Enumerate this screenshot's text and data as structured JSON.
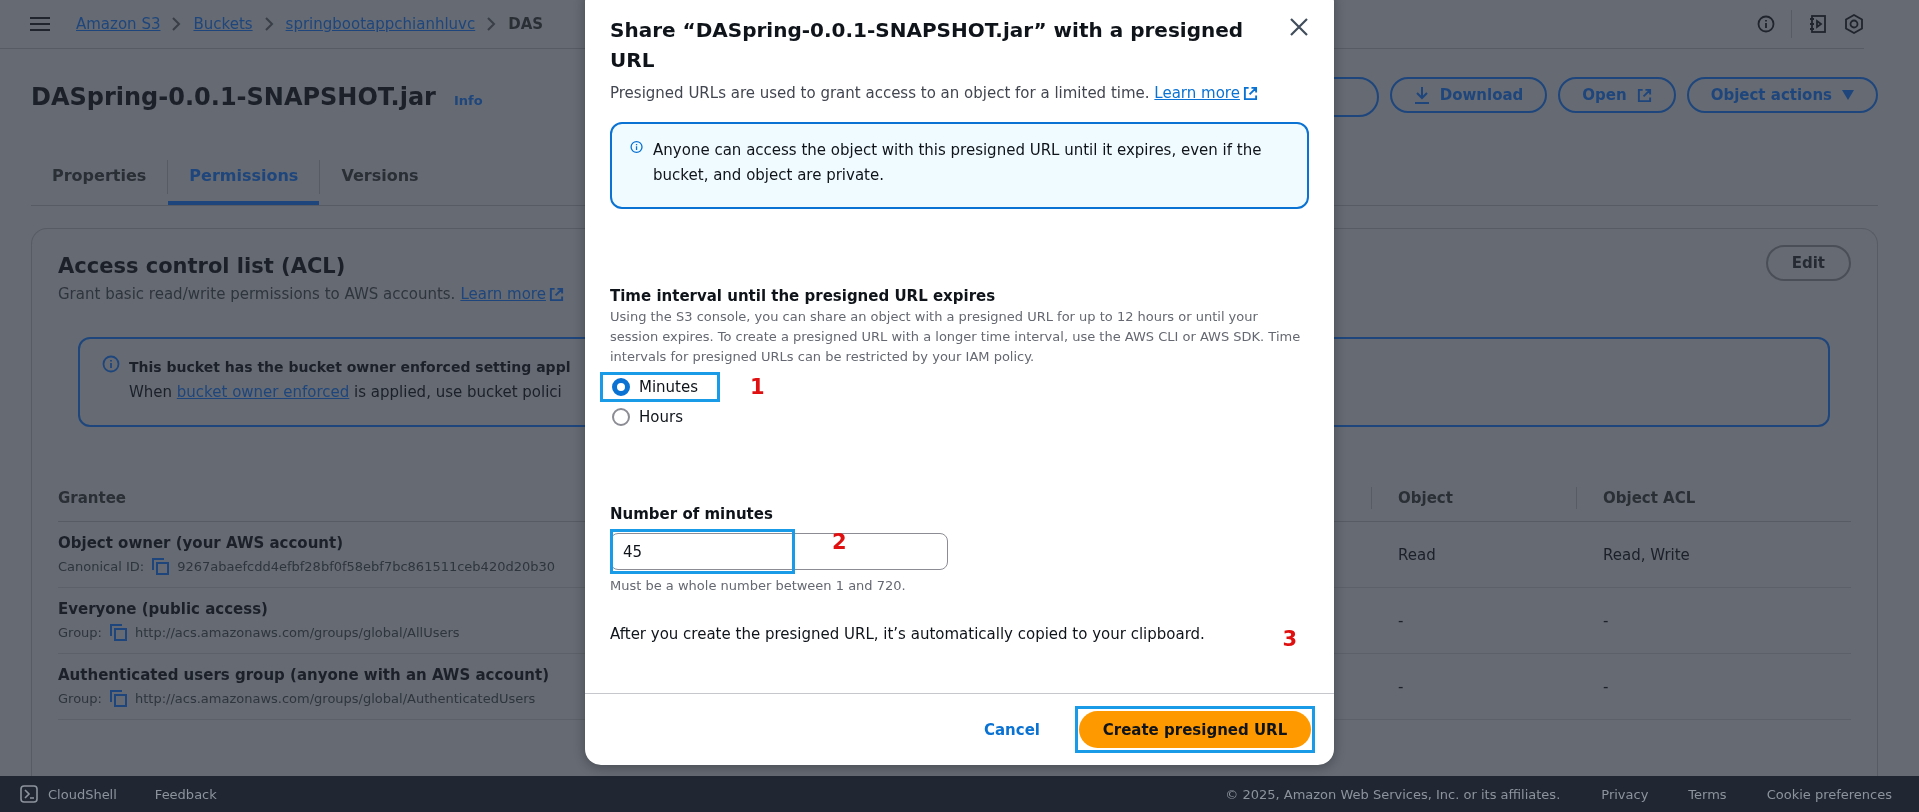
{
  "top_nav": {
    "breadcrumbs": [
      {
        "label": "Amazon S3",
        "link": true
      },
      {
        "label": "Buckets",
        "link": true
      },
      {
        "label": "springbootappchianhluvc",
        "link": true
      },
      {
        "label": "DAS",
        "link": false
      }
    ]
  },
  "object": {
    "title": "DASpring-0.0.1-SNAPSHOT.jar",
    "info": "Info",
    "actions": [
      {
        "label": "Download",
        "kind": "download"
      },
      {
        "label": "Open",
        "kind": "external"
      },
      {
        "label": "Object actions",
        "kind": "menu"
      }
    ]
  },
  "tabs": [
    {
      "label": "Properties",
      "selected": false
    },
    {
      "label": "Permissions",
      "selected": true
    },
    {
      "label": "Versions",
      "selected": false
    }
  ],
  "acl": {
    "title": "Access control list (ACL)",
    "description": "Grant basic read/write permissions to AWS accounts.",
    "learn_more": "Learn more",
    "edit": "Edit",
    "alert": {
      "title": "This bucket has the bucket owner enforced setting appl",
      "before": "When ",
      "link": "bucket owner enforced",
      "after": " is applied, use bucket polici"
    },
    "table": {
      "columns": [
        "Grantee",
        "Object",
        "Object ACL"
      ],
      "rows": [
        {
          "name": "Object owner (your AWS account)",
          "id_label": "Canonical ID:",
          "id": "9267abaefcdd4efbf28bf0f58ebf7bc861511ceb420d20b30",
          "object": "Read",
          "object_acl": "Read, Write"
        },
        {
          "name": "Everyone (public access)",
          "id_label": "Group:",
          "id": "http://acs.amazonaws.com/groups/global/AllUsers",
          "object": "-",
          "object_acl": "-"
        },
        {
          "name": "Authenticated users group (anyone with an AWS account)",
          "id_label": "Group:",
          "id": "http://acs.amazonaws.com/groups/global/AuthenticatedUsers",
          "object": "-",
          "object_acl": "-"
        }
      ]
    }
  },
  "modal": {
    "title": "Share “DASpring-0.0.1-SNAPSHOT.jar” with a presigned URL",
    "description": "Presigned URLs are used to grant access to an object for a limited time.",
    "learn_more": "Learn more",
    "alert": "Anyone can access the object with this presigned URL until it expires, even if the bucket, and object are private.",
    "interval_label": "Time interval until the presigned URL expires",
    "interval_help": "Using the S3 console, you can share an object with a presigned URL for up to 12 hours or until your session expires. To create a presigned URL with a longer time interval, use the AWS CLI or AWS SDK. Time intervals for presigned URLs can be restricted by your IAM policy.",
    "options": [
      {
        "label": "Minutes",
        "selected": true,
        "highlighted": true,
        "marker": "1"
      },
      {
        "label": "Hours",
        "selected": false,
        "highlighted": false
      }
    ],
    "input": {
      "label": "Number of minutes",
      "value": "45",
      "hint": "Must be a whole number between 1 and 720.",
      "highlighted": true,
      "marker": "2"
    },
    "note": "After you create the presigned URL, it’s automatically copied to your clipboard.",
    "note_marker": "3",
    "cancel": "Cancel",
    "create": {
      "label": "Create presigned URL",
      "highlighted": true
    }
  },
  "footer": {
    "cloudshell": "CloudShell",
    "feedback": "Feedback",
    "copyright": "© 2025, Amazon Web Services, Inc. or its affiliates.",
    "links": [
      "Privacy",
      "Terms",
      "Cookie preferences"
    ]
  }
}
